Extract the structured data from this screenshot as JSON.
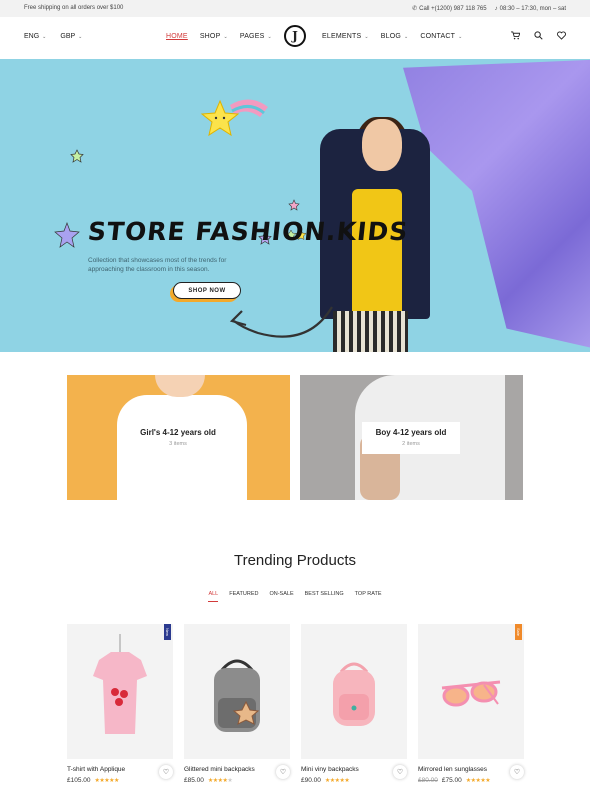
{
  "topbar": {
    "shipping": "Free shipping on all orders over $100",
    "phone": "Call +(1200) 987 118 765",
    "hours": "08:30 – 17:30, mon – sat"
  },
  "header": {
    "language": "ENG",
    "currency": "GBP",
    "nav_left": [
      "HOME",
      "SHOP",
      "PAGES"
    ],
    "nav_right": [
      "ELEMENTS",
      "BLOG",
      "CONTACT"
    ],
    "logo": "J",
    "icons": [
      "cart-icon",
      "search-icon",
      "heart-icon"
    ]
  },
  "hero": {
    "title": "STORE FASHION.KIDS",
    "text": "Collection that showcases most of the trends for approaching the classroom in this season.",
    "button": "SHOP NOW",
    "colors": {
      "background": "#8fd3e4",
      "accent": "#f3a92b"
    }
  },
  "categories": [
    {
      "title": "Girl's 4-12 years old",
      "count": "3 items"
    },
    {
      "title": "Boy 4-12 years old",
      "count": "2 items"
    }
  ],
  "trending": {
    "title": "Trending Products",
    "tabs": [
      "ALL",
      "FEATURED",
      "ON-SALE",
      "BEST SELLING",
      "TOP RATE"
    ],
    "products": [
      {
        "name": "T-shirt with Applique",
        "price": "£105.00",
        "old_price": "",
        "badge": "New",
        "rating": 5
      },
      {
        "name": "Glittered mini backpacks",
        "price": "£85.00",
        "old_price": "",
        "badge": "",
        "rating": 4
      },
      {
        "name": "Mini viny backpacks",
        "price": "£90.00",
        "old_price": "",
        "badge": "",
        "rating": 5
      },
      {
        "name": "Mirrored len sunglasses",
        "price": "£75.00",
        "old_price": "£80.00",
        "badge": "Sale",
        "rating": 5
      }
    ]
  }
}
